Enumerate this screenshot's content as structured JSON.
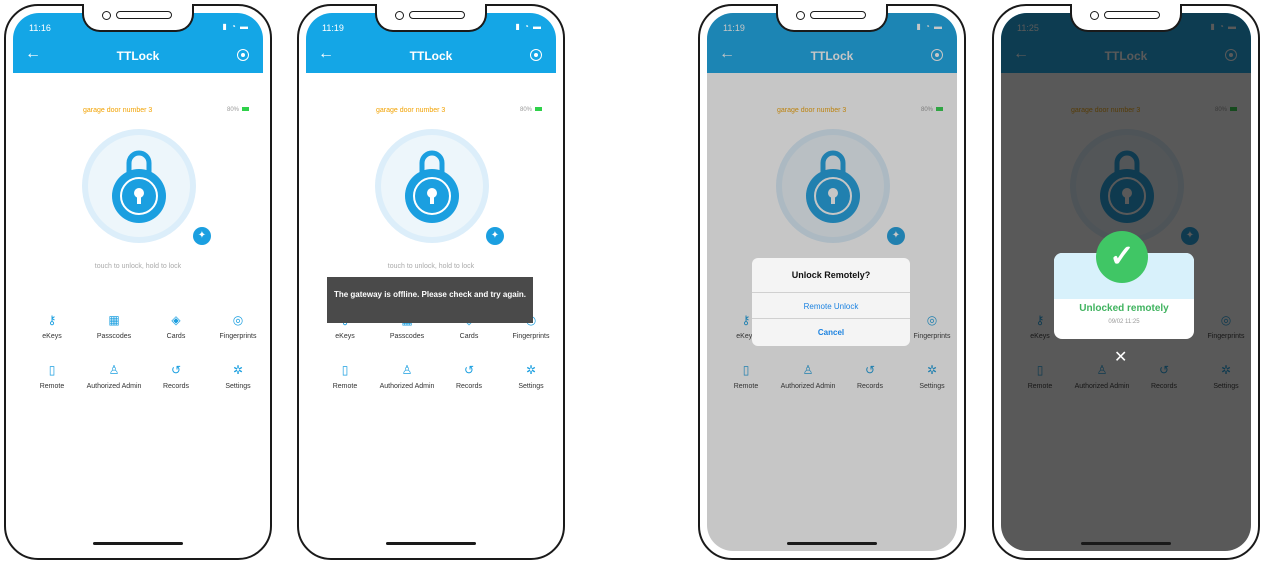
{
  "app": {
    "title": "TTLock",
    "lock_name": "garage door number 3",
    "battery": "80%",
    "hint": "touch to unlock, hold to lock"
  },
  "features": [
    {
      "label": "eKeys",
      "icon": "ekey-icon"
    },
    {
      "label": "Passcodes",
      "icon": "passcode-icon"
    },
    {
      "label": "Cards",
      "icon": "card-icon"
    },
    {
      "label": "Fingerprints",
      "icon": "fingerprint-icon"
    },
    {
      "label": "Remote",
      "icon": "remote-icon"
    },
    {
      "label": "Authorized Admin",
      "icon": "admin-icon"
    },
    {
      "label": "Records",
      "icon": "records-icon"
    },
    {
      "label": "Settings",
      "icon": "settings-icon"
    }
  ],
  "screens": [
    {
      "time": "11:16"
    },
    {
      "time": "11:19",
      "toast": "The gateway is offline. Please check and try again."
    },
    {
      "time": "11:19",
      "dialog": {
        "title": "Unlock Remotely?",
        "confirm": "Remote Unlock",
        "cancel": "Cancel"
      }
    },
    {
      "time": "11:25",
      "success": {
        "title": "Unlocked remotely",
        "datetime": "09/02 11:25"
      }
    }
  ],
  "colors": {
    "primary": "#14a6e6",
    "accent": "#f2a200",
    "success": "#40c665"
  }
}
